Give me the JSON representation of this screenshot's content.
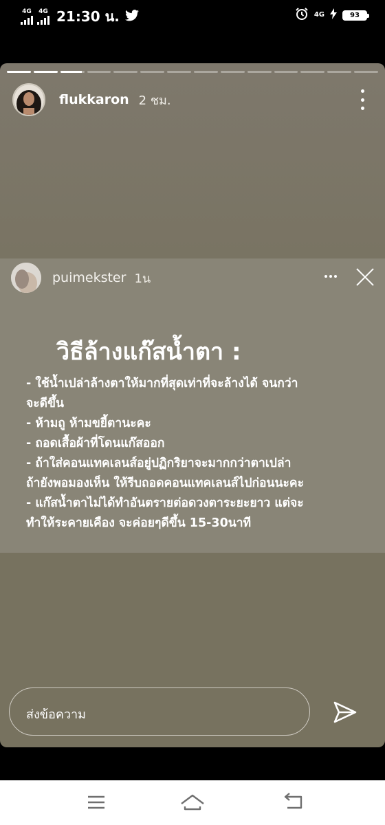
{
  "status_bar": {
    "network_1": "4G",
    "network_2": "4G",
    "time": "21:30 น.",
    "network_3": "4G",
    "battery": "93"
  },
  "story": {
    "progress": {
      "segments": 14,
      "completed": 2,
      "current_fraction": 0.9
    },
    "username": "flukkaron",
    "time_ago": "2 ชม.",
    "embedded_post": {
      "username": "puimekster",
      "time_ago": "1น",
      "heading": "วิธีล้างแก๊สน้ำตา :",
      "lines": [
        "- ใช้น้ำเปล่าล้างตาให้มากที่สุดเท่าที่จะล้างได้ จนกว่า",
        "จะดีขึ้น",
        "- ห้ามถู ห้ามขยี้ตานะคะ",
        "- ถอดเสื้อผ้าที่โดนแก๊สออก",
        "- ถ้าใส่คอนแทคเลนส์อยู่ปฏิกริยาจะมากกว่าตาเปล่า",
        "ถ้ายังพอมองเห็น ให้รีบถอดคอนแทคเลนส์ไปก่อนนะคะ",
        "- แก๊สน้ำตาไม่ได้ทำอันตรายต่อดวงตาระยะยาว แต่จะ",
        "ทำให้ระคายเคือง จะค่อยๆดีขึ้น 15-30นาที"
      ]
    },
    "reply_placeholder": "ส่งข้อความ"
  },
  "icons": [
    "twitter-bird-icon",
    "alarm-icon",
    "charging-bolt-icon",
    "more-vertical-icon",
    "more-horizontal-icon",
    "close-icon",
    "send-icon",
    "menu-icon",
    "home-icon",
    "back-icon"
  ],
  "colors": {
    "story_bg": "#77725f",
    "embed_bg": "#898577",
    "nav_bg": "#ffffff"
  }
}
